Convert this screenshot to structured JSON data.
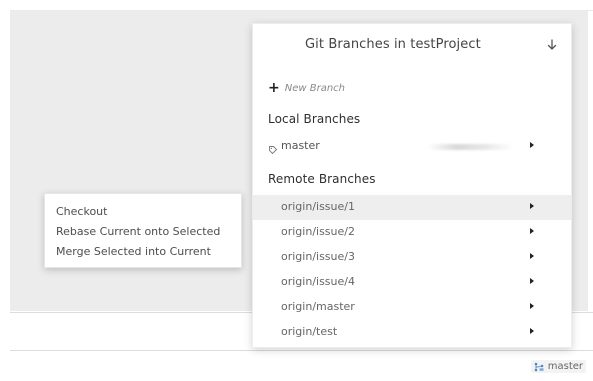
{
  "popup": {
    "title": "Git Branches in testProject",
    "new_branch_label": "New Branch",
    "local_heading": "Local Branches",
    "remote_heading": "Remote Branches",
    "local_branches": [
      {
        "name": "master"
      }
    ],
    "remote_branches": [
      {
        "name": "origin/issue/1"
      },
      {
        "name": "origin/issue/2"
      },
      {
        "name": "origin/issue/3"
      },
      {
        "name": "origin/issue/4"
      },
      {
        "name": "origin/master"
      },
      {
        "name": "origin/test"
      }
    ],
    "selected_remote_index": 0,
    "icons": {
      "down": "down-arrow-icon",
      "plus": "plus-icon",
      "branch": "tag-icon",
      "submenu": "chevron-right-icon"
    }
  },
  "context_menu": {
    "items": [
      {
        "label": "Checkout"
      },
      {
        "label": "Rebase Current onto Selected"
      },
      {
        "label": "Merge Selected into Current"
      }
    ]
  },
  "status_bar": {
    "branch": "master",
    "icon": "git-branch-icon"
  },
  "colors": {
    "workspace": "#ececec",
    "selected_row": "#eeeeee"
  }
}
